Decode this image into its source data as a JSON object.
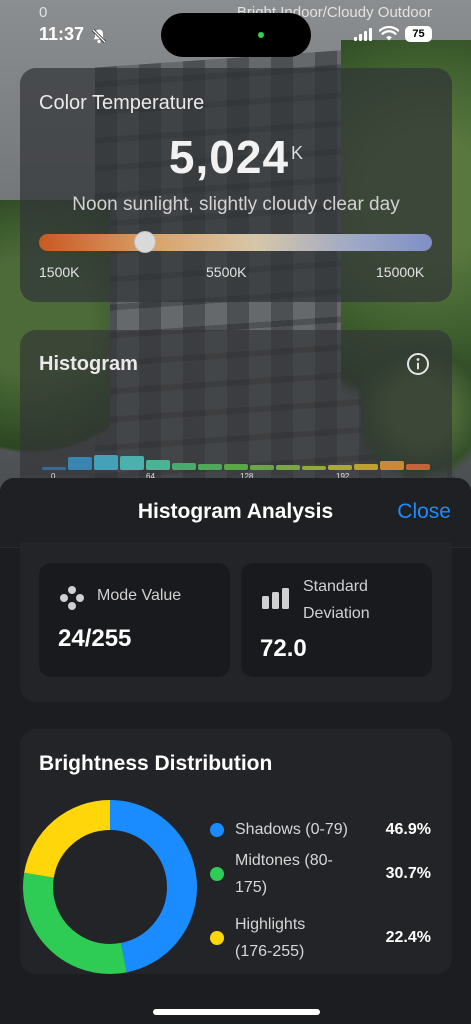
{
  "status": {
    "top_left": "0",
    "top_right": "Bright Indoor/Cloudy Outdoor",
    "time": "11:37",
    "battery": "75"
  },
  "color_temperature": {
    "title": "Color Temperature",
    "value": "5,024",
    "unit": "K",
    "description": "Noon sunlight, slightly cloudy clear day",
    "slider_fraction": 0.27,
    "scale": [
      "1500K",
      "5500K",
      "15000K"
    ]
  },
  "histogram": {
    "title": "Histogram",
    "ticks": [
      "0",
      "64",
      "128",
      "192"
    ],
    "bars": [
      {
        "level": 0.2,
        "color": "#2f6ea3"
      },
      {
        "level": 0.8,
        "color": "#3a86b0"
      },
      {
        "level": 0.95,
        "color": "#45a1b7"
      },
      {
        "level": 0.9,
        "color": "#4bb0ae"
      },
      {
        "level": 0.6,
        "color": "#4eb294"
      },
      {
        "level": 0.45,
        "color": "#4ca86f"
      },
      {
        "level": 0.4,
        "color": "#52a85a"
      },
      {
        "level": 0.35,
        "color": "#5aa747"
      },
      {
        "level": 0.3,
        "color": "#6aa83f"
      },
      {
        "level": 0.3,
        "color": "#7ca83a"
      },
      {
        "level": 0.28,
        "color": "#92aa38"
      },
      {
        "level": 0.3,
        "color": "#a8a936"
      },
      {
        "level": 0.35,
        "color": "#bca234"
      },
      {
        "level": 0.55,
        "color": "#c98a35"
      },
      {
        "level": 0.35,
        "color": "#c5643a"
      }
    ]
  },
  "sheet": {
    "title": "Histogram Analysis",
    "close_label": "Close"
  },
  "stats": {
    "mode_label": "Mode Value",
    "mode_value": "24/255",
    "std_label": "Standard Deviation",
    "std_value": "72.0"
  },
  "distribution": {
    "title": "Brightness Distribution",
    "segments": [
      {
        "label": "Shadows (0-79)",
        "percent": "46.9%",
        "value": 46.9,
        "color": "#1a8cff"
      },
      {
        "label": "Midtones (80-175)",
        "percent": "30.7%",
        "value": 30.7,
        "color": "#2ecc54"
      },
      {
        "label": "Highlights (176-255)",
        "percent": "22.4%",
        "value": 22.4,
        "color": "#ffd60a"
      }
    ]
  }
}
